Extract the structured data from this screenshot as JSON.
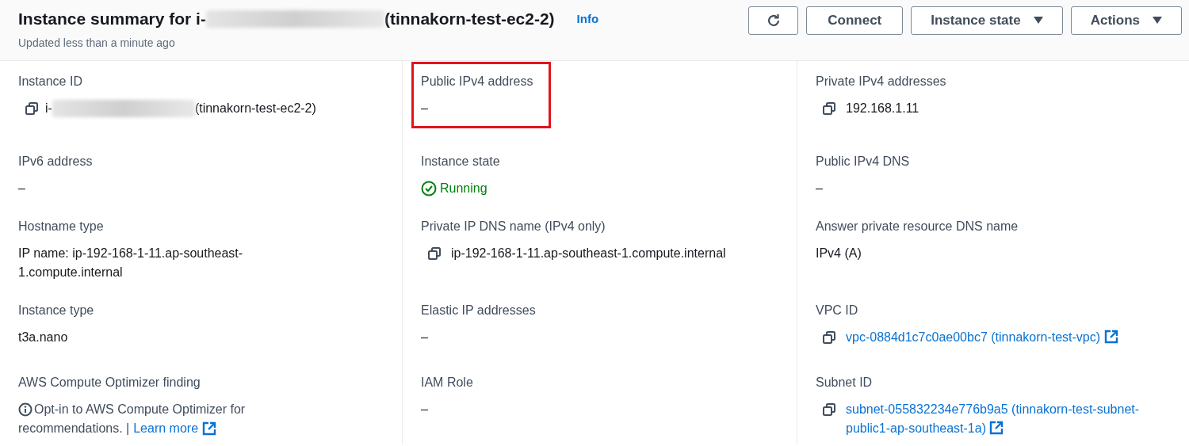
{
  "header": {
    "title_prefix": "Instance summary for i-",
    "title_suffix": "(tinnakorn-test-ec2-2)",
    "info_link": "Info",
    "subtitle": "Updated less than a minute ago",
    "buttons": [
      {
        "kind": "refresh"
      },
      {
        "kind": "text",
        "label": "Connect"
      },
      {
        "kind": "dropdown",
        "label": "Instance state"
      },
      {
        "kind": "dropdown",
        "label": "Actions"
      }
    ]
  },
  "rows": [
    {
      "fields": [
        {
          "label": "Instance ID",
          "kind": "redacted",
          "highlighted": false,
          "prefix": "i-",
          "value": "(tinnakorn-test-ec2-2)"
        },
        {
          "label": "Public IPv4 address",
          "kind": "text",
          "highlighted": true,
          "value": "–"
        },
        {
          "label": "Private IPv4 addresses",
          "kind": "copy",
          "highlighted": false,
          "value": "192.168.1.11"
        }
      ]
    },
    {
      "fields": [
        {
          "label": "IPv6 address",
          "kind": "text",
          "highlighted": false,
          "value": "–"
        },
        {
          "label": "Instance state",
          "kind": "status",
          "highlighted": false,
          "value": "Running"
        },
        {
          "label": "Public IPv4 DNS",
          "kind": "text",
          "highlighted": false,
          "value": "–"
        }
      ]
    },
    {
      "fields": [
        {
          "label": "Hostname type",
          "kind": "text",
          "highlighted": false,
          "value": "IP name: ip-192-168-1-11.ap-southeast-1.compute.internal"
        },
        {
          "label": "Private IP DNS name (IPv4 only)",
          "kind": "copy",
          "highlighted": false,
          "value": "ip-192-168-1-11.ap-southeast-1.compute.internal"
        },
        {
          "label": "Answer private resource DNS name",
          "kind": "text",
          "highlighted": false,
          "value": "IPv4 (A)"
        }
      ]
    },
    {
      "fields": [
        {
          "label": "Instance type",
          "kind": "text",
          "highlighted": false,
          "value": "t3a.nano"
        },
        {
          "label": "Elastic IP addresses",
          "kind": "text",
          "highlighted": false,
          "value": "–"
        },
        {
          "label": "VPC ID",
          "kind": "link",
          "highlighted": false,
          "value": "vpc-0884d1c7c0ae00bc7 (tinnakorn-test-vpc)"
        }
      ]
    },
    {
      "fields": [
        {
          "label": "AWS Compute Optimizer finding",
          "kind": "optimizer",
          "highlighted": false,
          "lines": [
            "Opt-in to AWS Compute Optimizer for",
            "recommendations. |"
          ],
          "link": "Learn more"
        },
        {
          "label": "IAM Role",
          "kind": "text",
          "highlighted": false,
          "value": "–"
        },
        {
          "label": "Subnet ID",
          "kind": "link",
          "highlighted": false,
          "value": "subnet-055832234e776b9a5 (tinnakorn-test-subnet-public1-ap-southeast-1a)"
        }
      ]
    }
  ]
}
